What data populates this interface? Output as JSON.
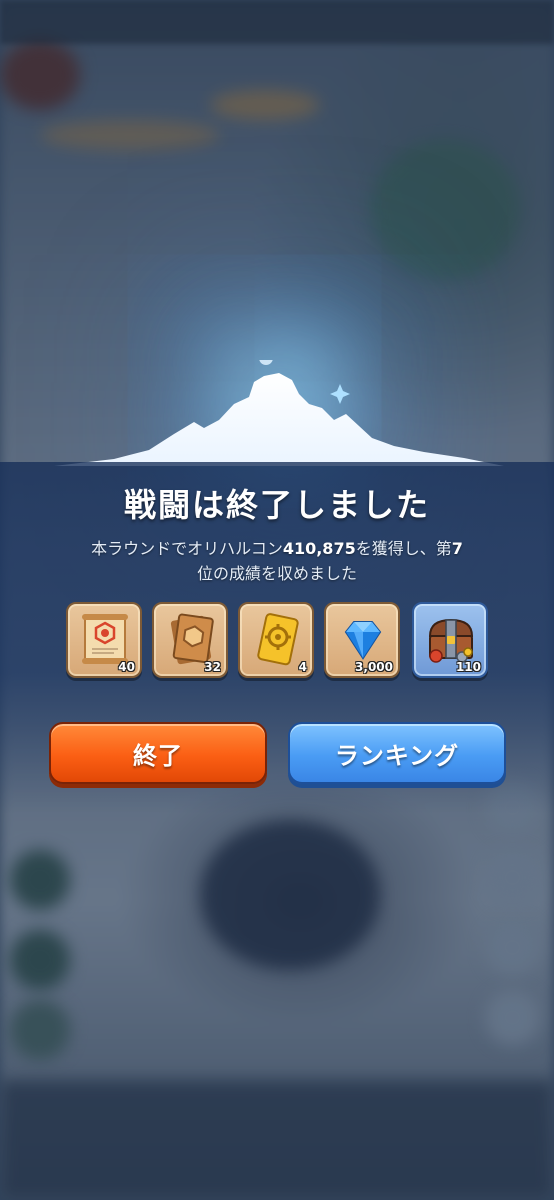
{
  "result": {
    "title": "戦闘は終了しました",
    "desc_prefix": "本ラウンドでオリハルコン",
    "amount": "410,875",
    "desc_middle": "を獲得し、第",
    "rank": "7",
    "desc_suffix": "位の成績を収めました"
  },
  "rewards": [
    {
      "icon": "scroll-icon",
      "count": "40"
    },
    {
      "icon": "bronze-card-icon",
      "count": "32"
    },
    {
      "icon": "gold-ticket-icon",
      "count": "4"
    },
    {
      "icon": "diamond-icon",
      "count": "3,000"
    },
    {
      "icon": "treasure-chest-icon",
      "count": "110"
    }
  ],
  "buttons": {
    "exit_label": "終了",
    "ranking_label": "ランキング"
  },
  "colors": {
    "exit_button": "#fb5f14",
    "ranking_button": "#4a9cf4",
    "panel_band": "#1a3460"
  }
}
